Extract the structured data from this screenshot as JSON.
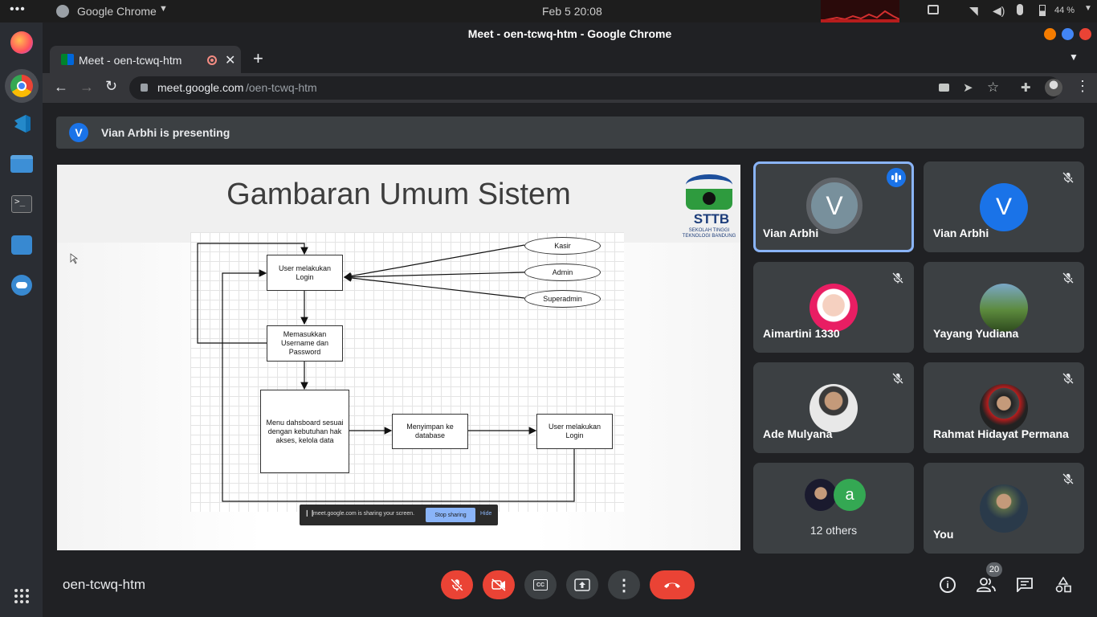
{
  "topbar": {
    "app_name": "Google Chrome",
    "datetime": "Feb 5  20:08",
    "battery": "44 %"
  },
  "window": {
    "title": "Meet - oen-tcwq-htm - Google Chrome"
  },
  "tab": {
    "label": "Meet - oen-tcwq-htm"
  },
  "address": {
    "host": "meet.google.com",
    "path": "/oen-tcwq-htm"
  },
  "banner": {
    "avatar_letter": "V",
    "text": "Vian Arbhi is presenting"
  },
  "slide": {
    "title": "Gambaran Umum Sistem",
    "logo_text": "STTB",
    "logo_sub1": "SEKOLAH TINGGI",
    "logo_sub2": "TEKNOLOGI BANDUNG",
    "boxes": {
      "login": "User melakukan Login",
      "input": "Memasukkan Username dan Password",
      "menu": "Menu dahsboard sesuai dengan kebutuhan hak akses, kelola data",
      "save": "Menyimpan ke database",
      "login2": "User melakukan Login"
    },
    "actors": [
      "Kasir",
      "Admin",
      "Superadmin"
    ],
    "share_bar": {
      "text": "meet.google.com is sharing your screen.",
      "stop": "Stop sharing",
      "hide": "Hide"
    }
  },
  "participants": [
    {
      "name": "Vian Arbhi",
      "letter": "V"
    },
    {
      "name": "Vian Arbhi",
      "letter": "V"
    },
    {
      "name": "Aimartini 1330"
    },
    {
      "name": "Yayang Yudiana"
    },
    {
      "name": "Ade Mulyana"
    },
    {
      "name": "Rahmat Hidayat Permana"
    },
    {
      "name": "12 others",
      "letter": "a"
    },
    {
      "name": "You"
    }
  ],
  "bottom": {
    "meeting_code": "oen-tcwq-htm",
    "people_count": "20"
  },
  "colors": {
    "accent": "#8ab4f8",
    "danger": "#ea4335",
    "tile": "#3c4043"
  }
}
